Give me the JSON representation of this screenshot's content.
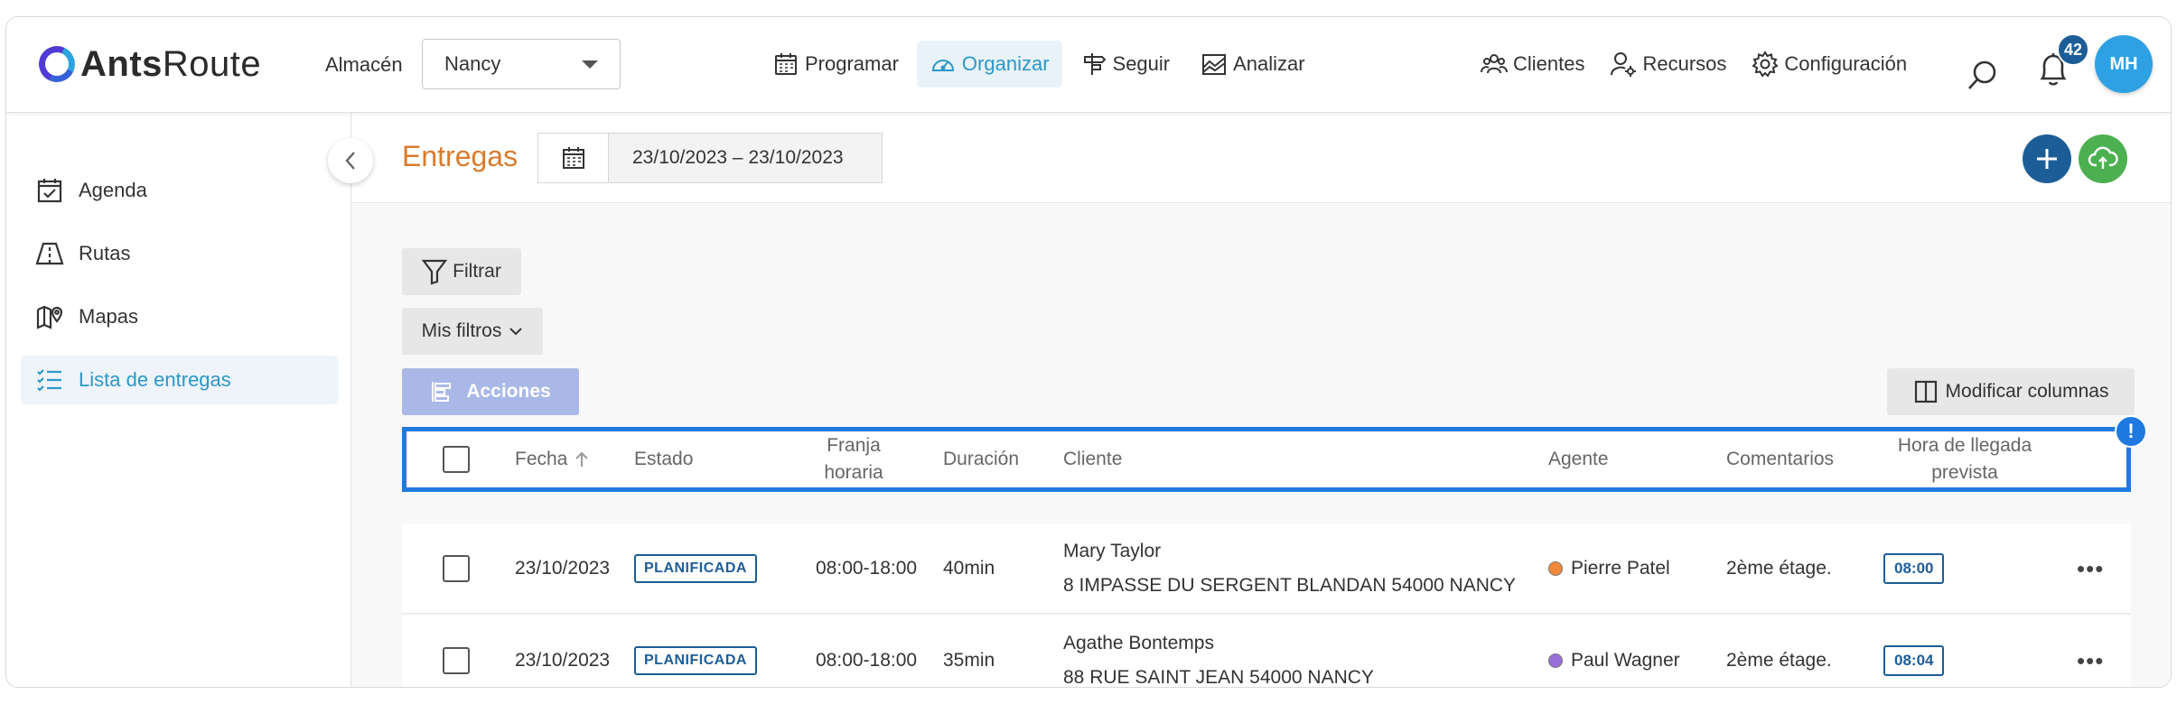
{
  "app": {
    "logo_strong": "Ants",
    "logo_light": "Route",
    "warehouse_label": "Almacén",
    "warehouse_value": "Nancy"
  },
  "nav": {
    "programar": "Programar",
    "organizar": "Organizar",
    "seguir": "Seguir",
    "analizar": "Analizar",
    "clientes": "Clientes",
    "recursos": "Recursos",
    "configuracion": "Configuración",
    "notifications_count": "42",
    "avatar_initials": "MH"
  },
  "sidebar": {
    "items": [
      {
        "label": "Agenda"
      },
      {
        "label": "Rutas"
      },
      {
        "label": "Mapas"
      },
      {
        "label": "Lista de entregas"
      }
    ]
  },
  "main": {
    "title": "Entregas",
    "date_range": "23/10/2023 – 23/10/2023",
    "filter_label": "Filtrar",
    "my_filters_label": "Mis filtros",
    "actions_label": "Acciones",
    "modify_columns_label": "Modificar columnas",
    "warning_mark": "!"
  },
  "table": {
    "headers": {
      "fecha": "Fecha",
      "estado": "Estado",
      "franja_1": "Franja",
      "franja_2": "horaria",
      "duracion": "Duración",
      "cliente": "Cliente",
      "agente": "Agente",
      "comentarios": "Comentarios",
      "hora_1": "Hora de llegada",
      "hora_2": "prevista"
    },
    "rows": [
      {
        "fecha": "23/10/2023",
        "estado": "PLANIFICADA",
        "franja": "08:00-18:00",
        "duracion": "40min",
        "cliente_nombre": "Mary Taylor",
        "cliente_direccion": "8 IMPASSE DU SERGENT BLANDAN 54000 NANCY",
        "agente": "Pierre Patel",
        "agente_color": "#f0883a",
        "comentarios": "2ème étage.",
        "hora": "08:00"
      },
      {
        "fecha": "23/10/2023",
        "estado": "PLANIFICADA",
        "franja": "08:00-18:00",
        "duracion": "35min",
        "cliente_nombre": "Agathe Bontemps",
        "cliente_direccion": "88 RUE SAINT JEAN 54000 NANCY",
        "agente": "Paul Wagner",
        "agente_color": "#9b6fd8",
        "comentarios": "2ème étage.",
        "hora": "08:04"
      }
    ]
  },
  "colors": {
    "accent": "#2c97c9",
    "primary": "#1d5d97",
    "title_orange": "#d97b2e",
    "highlight": "#1e7ae0"
  }
}
